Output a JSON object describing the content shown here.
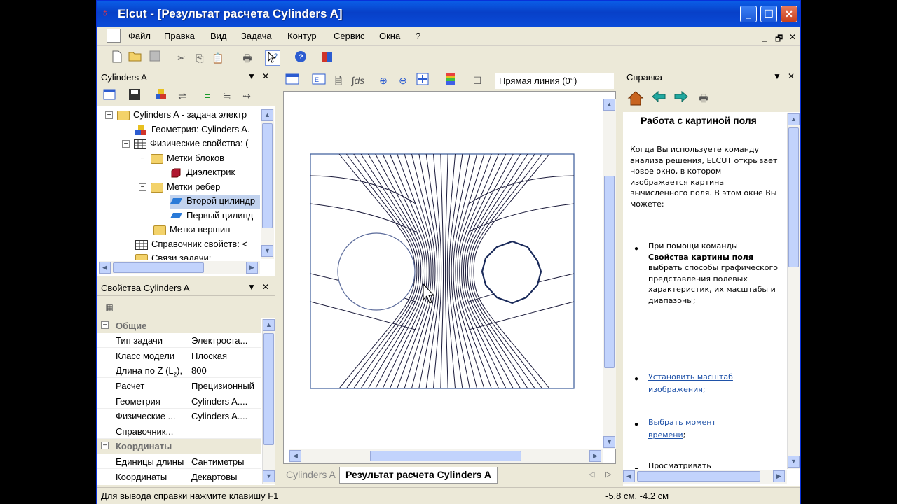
{
  "window": {
    "title": "Elcut - [Результат расчета Cylinders A]",
    "min_label": "_",
    "max_label": "❐",
    "close_label": "✕"
  },
  "menu": {
    "items": [
      "Файл",
      "Правка",
      "Вид",
      "Задача",
      "Контур",
      "Сервис",
      "Окна",
      "?"
    ],
    "mdi_controls": [
      "_",
      "🗗",
      "✕"
    ]
  },
  "tree_pane": {
    "title": "Cylinders A",
    "items": [
      {
        "label": "Cylinders A - задача электр",
        "icon": "folder-icon",
        "expander": "−"
      },
      {
        "label": "Геометрия: Cylinders A.",
        "icon": "geometry-icon",
        "expander": ""
      },
      {
        "label": "Физические свойства: (",
        "icon": "table-icon",
        "expander": "−"
      },
      {
        "label": "Метки блоков",
        "icon": "folder-icon",
        "expander": "−"
      },
      {
        "label": "Диэлектрик",
        "icon": "block-label-icon",
        "expander": ""
      },
      {
        "label": "Метки ребер",
        "icon": "folder-icon",
        "expander": "−"
      },
      {
        "label": "Второй цилиндр",
        "icon": "edge-label-icon",
        "expander": ""
      },
      {
        "label": "Первый цилинд",
        "icon": "edge-label-icon",
        "expander": ""
      },
      {
        "label": "Метки вершин",
        "icon": "folder-icon",
        "expander": ""
      },
      {
        "label": "Справочник свойств: <",
        "icon": "table-icon",
        "expander": ""
      },
      {
        "label": "Связи задачи:",
        "icon": "folder-icon",
        "expander": ""
      }
    ]
  },
  "props_pane": {
    "title": "Свойства Cylinders A",
    "categories": [
      {
        "name": "Общие",
        "rows": [
          {
            "key": "Тип задачи",
            "value": "Электроста..."
          },
          {
            "key": "Класс модели",
            "value": "Плоская"
          },
          {
            "key": "Длина по Z (L",
            "key_sub": "z",
            "key_tail": "),",
            "value": "800"
          },
          {
            "key": "Расчет",
            "value": "Прецизионный"
          },
          {
            "key": "Геометрия",
            "value": "Cylinders A...."
          },
          {
            "key": "Физические ...",
            "value": "Cylinders A...."
          },
          {
            "key": "Справочник...",
            "value": ""
          }
        ]
      },
      {
        "name": "Координаты",
        "rows": [
          {
            "key": "Единицы длины",
            "value": "Сантиметры"
          },
          {
            "key": "Координаты",
            "value": "Декартовы"
          }
        ]
      }
    ]
  },
  "view": {
    "line_label": "Прямая линия (0°)"
  },
  "tabs": {
    "inactive": "Cylinders A",
    "active": "Результат расчета Cylinders A"
  },
  "help_pane": {
    "title": "Справка",
    "heading": "Работа с картиной поля",
    "intro": "Когда Вы используете команду анализа решения, ELCUT открывает новое окно, в котором изображается картина вычисленного поля. В этом окне Вы можете:",
    "bullet1_prefix": "При помощи команды",
    "bullet1_bold": "Свойства картины поля",
    "bullet1_suffix": "выбрать способы графического представления полевых характеристик, их масштабы и диапазоны;",
    "link1": "Установить масштаб изображения;",
    "link2": "Выбрать момент времени",
    "link2_tail": ";",
    "bullet4": "Просматривать"
  },
  "status": {
    "hint": "Для вывода справки нажмите клавишу F1",
    "coords": "-5.8 см, -4.2 см"
  },
  "colors": {
    "titlebar": "#0a4bd8",
    "chrome": "#ece9d8",
    "field_lines": "#1a1a3a",
    "link": "#1f52a8"
  }
}
